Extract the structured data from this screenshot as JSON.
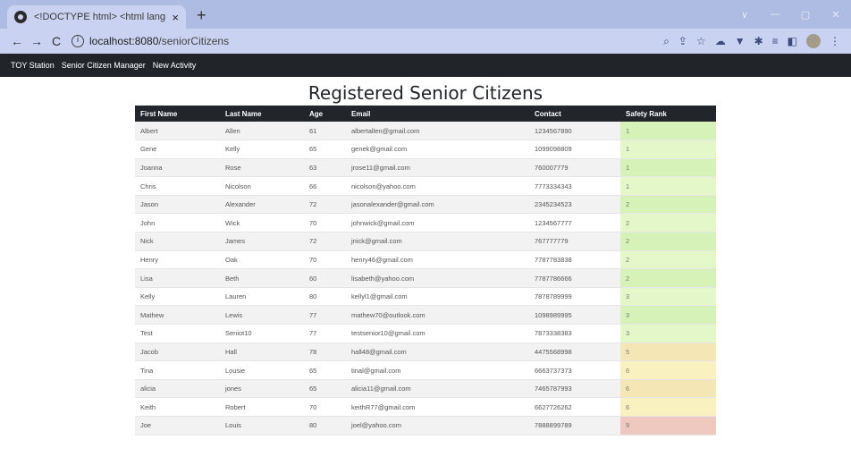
{
  "browser": {
    "tab_title": "<!DOCTYPE html> <html lang=",
    "tab_close": "×",
    "new_tab": "+",
    "url_host": "localhost:8080",
    "url_path": "/seniorCitizens",
    "window_controls": [
      "∨",
      "—",
      "▢",
      "✕"
    ]
  },
  "nav": {
    "brand": "TOY Station",
    "items": [
      "Senior Citizen Manager",
      "New Activity"
    ]
  },
  "page": {
    "title": "Registered Senior Citizens"
  },
  "table": {
    "headers": [
      "First Name",
      "Last Name",
      "Age",
      "Email",
      "Contact",
      "Safety Rank"
    ],
    "rows": [
      {
        "first": "Albert",
        "last": "Allen",
        "age": "61",
        "email": "albertallen@gmail.com",
        "contact": "1234567890",
        "rank": "1"
      },
      {
        "first": "Gene",
        "last": "Kelly",
        "age": "65",
        "email": "genek@gmail.com",
        "contact": "1099098809",
        "rank": "1"
      },
      {
        "first": "Joanna",
        "last": "Rose",
        "age": "63",
        "email": "jrose11@gmail.com",
        "contact": "760007779",
        "rank": "1"
      },
      {
        "first": "Chris",
        "last": "Nicolson",
        "age": "66",
        "email": "nicolson@yahoo.com",
        "contact": "7773334343",
        "rank": "1"
      },
      {
        "first": "Jason",
        "last": "Alexander",
        "age": "72",
        "email": "jasonalexander@gmail.com",
        "contact": "2345234523",
        "rank": "2"
      },
      {
        "first": "John",
        "last": "Wick",
        "age": "70",
        "email": "johnwick@gmail.com",
        "contact": "1234567777",
        "rank": "2"
      },
      {
        "first": "Nick",
        "last": "James",
        "age": "72",
        "email": "jnick@gmail.com",
        "contact": "767777779",
        "rank": "2"
      },
      {
        "first": "Henry",
        "last": "Oak",
        "age": "70",
        "email": "henry46@gmail.com",
        "contact": "7787783838",
        "rank": "2"
      },
      {
        "first": "Lisa",
        "last": "Beth",
        "age": "60",
        "email": "lisabeth@yahoo.com",
        "contact": "7787786666",
        "rank": "2"
      },
      {
        "first": "Kelly",
        "last": "Lauren",
        "age": "80",
        "email": "kellyl1@gmail.com",
        "contact": "7878789999",
        "rank": "3"
      },
      {
        "first": "Mathew",
        "last": "Lewis",
        "age": "77",
        "email": "mathew70@outlook.com",
        "contact": "1098989995",
        "rank": "3"
      },
      {
        "first": "Test",
        "last": "Seniot10",
        "age": "77",
        "email": "testsenior10@gmail.com",
        "contact": "7873338383",
        "rank": "3"
      },
      {
        "first": "Jacob",
        "last": "Hall",
        "age": "78",
        "email": "hall48@gmail.com",
        "contact": "4475568998",
        "rank": "5"
      },
      {
        "first": "Tina",
        "last": "Lousie",
        "age": "65",
        "email": "tinal@gmail.com",
        "contact": "6663737373",
        "rank": "6"
      },
      {
        "first": "alicia",
        "last": "jones",
        "age": "65",
        "email": "alicia11@gmail.com",
        "contact": "7465787993",
        "rank": "6"
      },
      {
        "first": "Keith",
        "last": "Robert",
        "age": "70",
        "email": "keithR77@gmail.com",
        "contact": "6627726262",
        "rank": "6"
      },
      {
        "first": "Joe",
        "last": "Louis",
        "age": "80",
        "email": "joel@yahoo.com",
        "contact": "7888899789",
        "rank": "9"
      }
    ]
  },
  "colors": {
    "rank_low": "#d6f2b8",
    "rank_low_alt": "#e3f7c8",
    "rank_mid": "#f4e7b5",
    "rank_mid_alt": "#faf1c0",
    "rank_high": "#efc8c0",
    "header_bg": "#22262b",
    "nav_bg": "#21252a"
  }
}
